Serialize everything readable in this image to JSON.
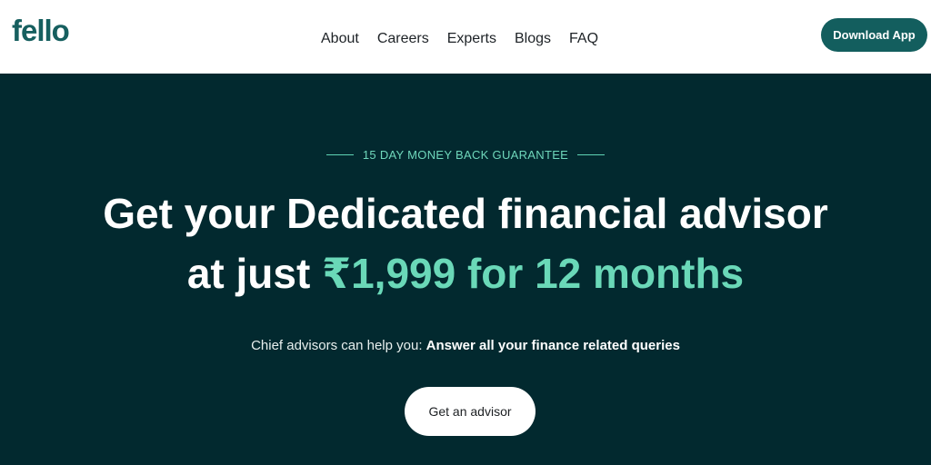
{
  "header": {
    "logo": "fello",
    "nav": [
      "About",
      "Careers",
      "Experts",
      "Blogs",
      "FAQ"
    ],
    "download_label": "Download App"
  },
  "hero": {
    "guarantee": "15 DAY MONEY BACK GUARANTEE",
    "headline_line1": "Get your Dedicated financial advisor",
    "headline_line2_prefix": "at just",
    "headline_line2_accent": "₹1,999 for 12 months",
    "subtext_prefix": "Chief advisors can help you:",
    "subtext_bold": "Answer all your finance related queries",
    "cta_label": "Get an advisor"
  },
  "colors": {
    "brand": "#135e5e",
    "hero_bg": "#02292f",
    "accent": "#6ad8b8"
  }
}
